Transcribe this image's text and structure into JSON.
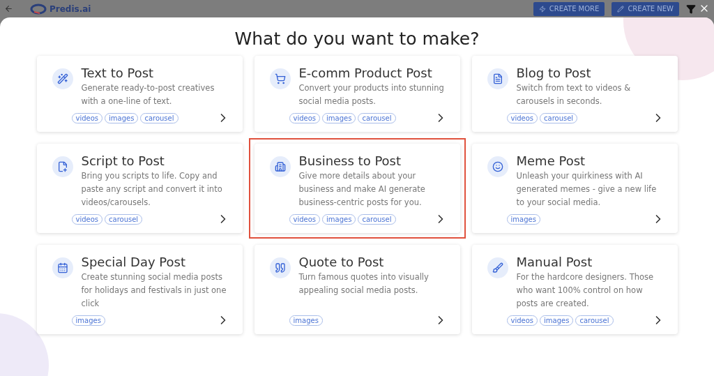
{
  "header": {
    "logo": "Predis.ai",
    "buttons": [
      {
        "label": "CREATE MORE",
        "kind": "bolt"
      },
      {
        "label": "CREATE NEW",
        "kind": "pencil"
      }
    ]
  },
  "modal": {
    "title": "What do you want to make?"
  },
  "cards": [
    {
      "title": "Text to Post",
      "description": "Generate ready-to-post creatives with a one-line of text.",
      "tags": [
        "videos",
        "images",
        "carousel"
      ],
      "selected": false
    },
    {
      "title": "E-comm Product Post",
      "description": "Convert your products into stunning social media posts.",
      "tags": [
        "videos",
        "images",
        "carousel"
      ],
      "selected": false
    },
    {
      "title": "Blog to Post",
      "description": "Switch from text to videos & carousels in seconds.",
      "tags": [
        "videos",
        "carousel"
      ],
      "selected": false
    },
    {
      "title": "Script to Post",
      "description": "Bring you scripts to life. Copy and paste any script and convert it into videos/carousels.",
      "tags": [
        "videos",
        "carousel"
      ],
      "selected": false
    },
    {
      "title": "Business to Post",
      "description": "Give more details about your business and make AI generate business-centric posts for you.",
      "tags": [
        "videos",
        "images",
        "carousel"
      ],
      "selected": true
    },
    {
      "title": "Meme Post",
      "description": "Unleash your quirkiness with AI generated memes - give a new life to your social media.",
      "tags": [
        "images"
      ],
      "selected": false
    },
    {
      "title": "Special Day Post",
      "description": "Create stunning social media posts for holidays and festivals in just one click",
      "tags": [
        "images"
      ],
      "selected": false
    },
    {
      "title": "Quote to Post",
      "description": "Turn famous quotes into visually appealing social media posts.",
      "tags": [
        "images"
      ],
      "selected": false
    },
    {
      "title": "Manual Post",
      "description": "For the hardcore designers. Those who want 100% control on how posts are created.",
      "tags": [
        "videos",
        "images",
        "carousel"
      ],
      "selected": false
    }
  ]
}
